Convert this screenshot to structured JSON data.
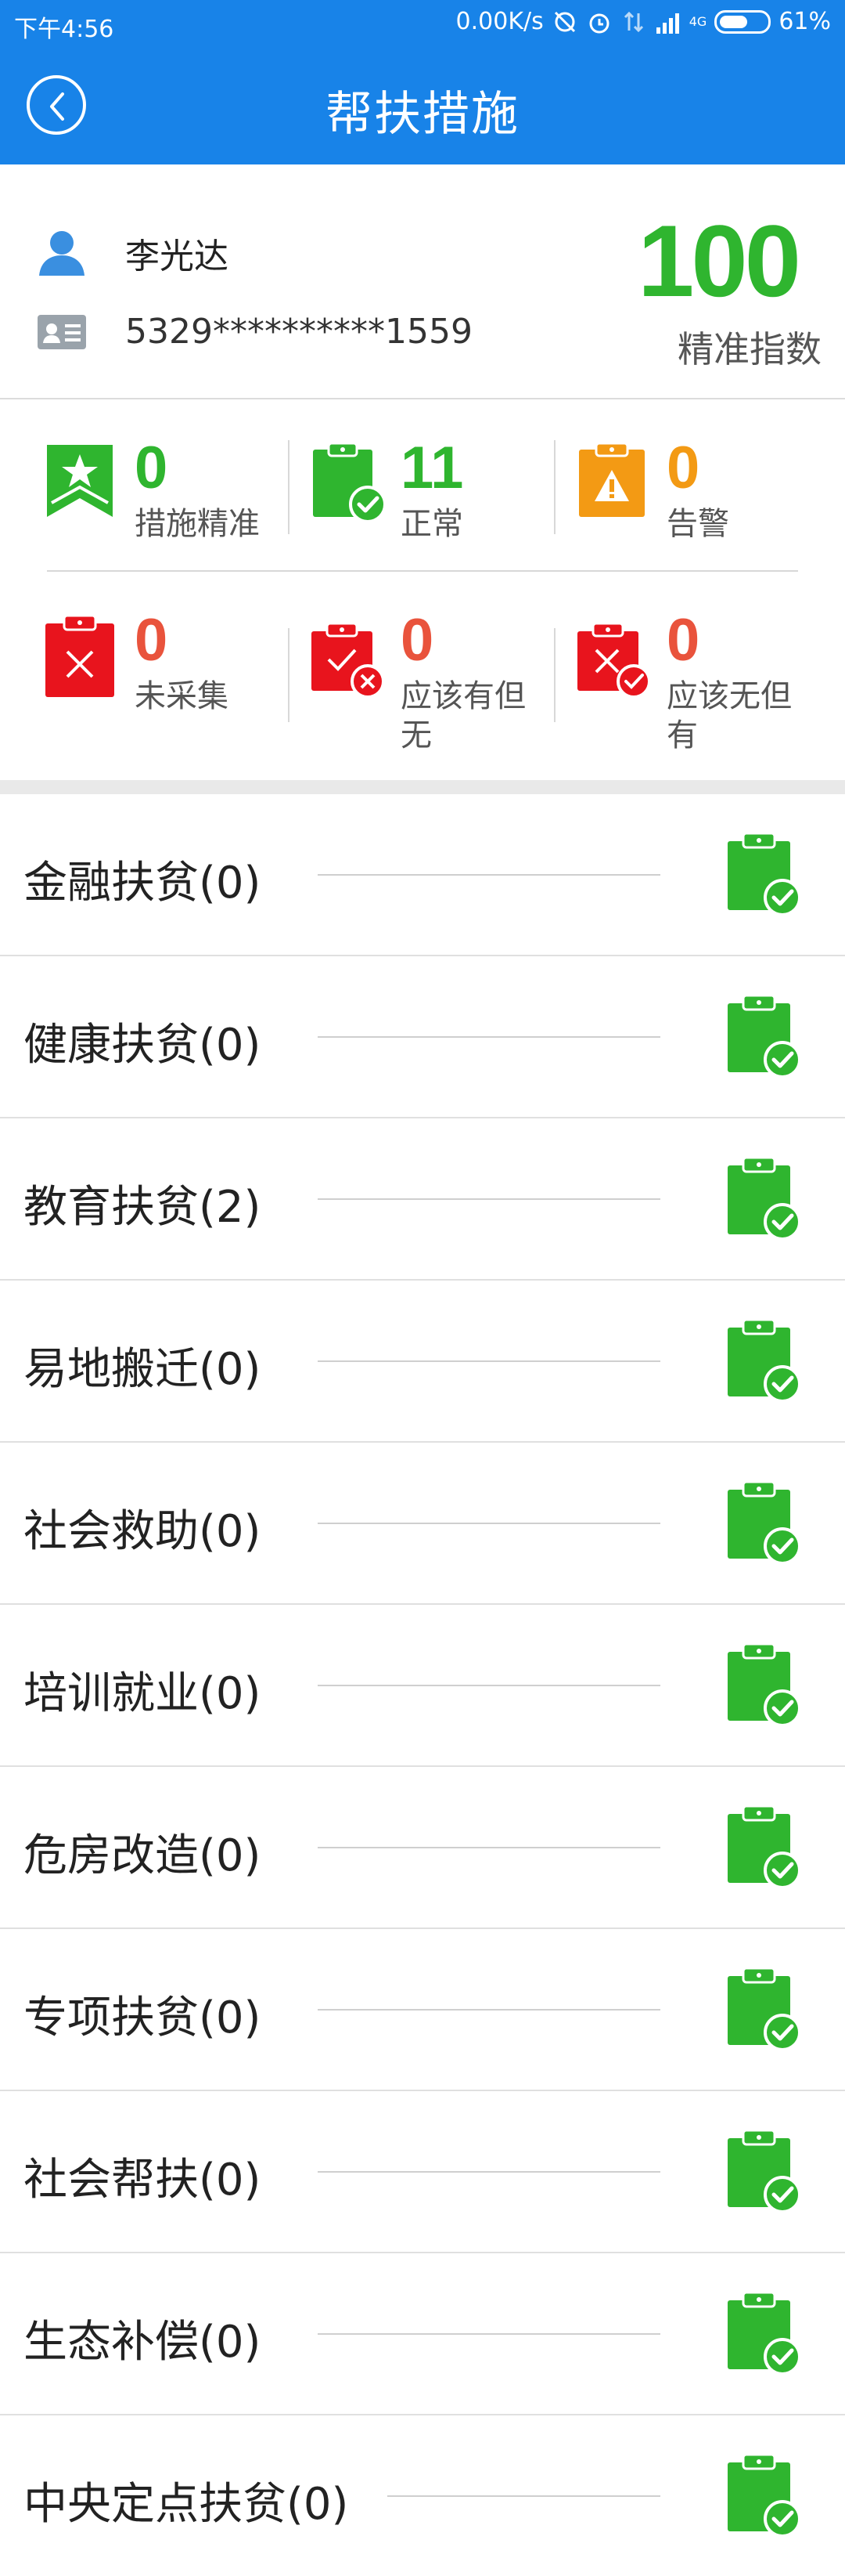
{
  "status_bar": {
    "time": "下午4:56",
    "speed": "0.00K/s",
    "network": "4G",
    "battery": "61%",
    "battery_level": 0.61
  },
  "header": {
    "title": "帮扶措施"
  },
  "person": {
    "name": "李光达",
    "id_number": "5329**********1559",
    "score": "100",
    "score_label": "精准指数"
  },
  "stats": [
    {
      "value": "0",
      "label": "措施精准",
      "color": "#2fb52f",
      "icon": "star-ribbon-icon"
    },
    {
      "value": "11",
      "label": "正常",
      "color": "#2fb52f",
      "icon": "clipboard-check-icon"
    },
    {
      "value": "0",
      "label": "告警",
      "color": "#f39a14",
      "icon": "clipboard-warning-icon"
    },
    {
      "value": "0",
      "label": "未采集",
      "color": "#e9533c",
      "icon": "clipboard-cross-icon"
    },
    {
      "value": "0",
      "label": "应该有但无",
      "color": "#e9533c",
      "icon": "clipboard-check-x-icon"
    },
    {
      "value": "0",
      "label": "应该无但有",
      "color": "#e9533c",
      "icon": "clipboard-x-check-icon"
    }
  ],
  "measures": [
    {
      "label": "金融扶贫(0)",
      "icon": "clipboard-ok-icon"
    },
    {
      "label": "健康扶贫(0)",
      "icon": "clipboard-ok-icon"
    },
    {
      "label": "教育扶贫(2)",
      "icon": "clipboard-ok-icon"
    },
    {
      "label": "易地搬迁(0)",
      "icon": "clipboard-ok-icon"
    },
    {
      "label": "社会救助(0)",
      "icon": "clipboard-ok-icon"
    },
    {
      "label": "培训就业(0)",
      "icon": "clipboard-ok-icon"
    },
    {
      "label": "危房改造(0)",
      "icon": "clipboard-ok-icon"
    },
    {
      "label": "专项扶贫(0)",
      "icon": "clipboard-ok-icon"
    },
    {
      "label": "社会帮扶(0)",
      "icon": "clipboard-ok-icon"
    },
    {
      "label": "生态补偿(0)",
      "icon": "clipboard-ok-icon"
    },
    {
      "label": "中央定点扶贫(0)",
      "icon": "clipboard-ok-icon"
    }
  ],
  "colors": {
    "primary": "#1883e8",
    "green": "#2fb52f",
    "orange": "#f39a14",
    "red": "#e9533c"
  }
}
